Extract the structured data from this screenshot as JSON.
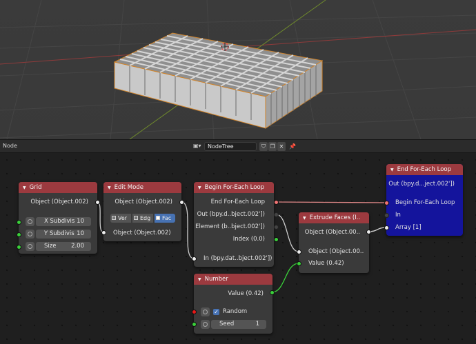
{
  "editor": {
    "type_label": "Node",
    "tree_name": "NodeTree"
  },
  "icons": {
    "tree_type": "node-tree-icon",
    "shield": "fake-user-shield-icon",
    "duplicate": "duplicate-icon",
    "close": "unlink-x-icon",
    "pin": "pin-icon"
  },
  "colors": {
    "node_header": "#9c3a3f",
    "active_node": "#14149c",
    "socket_object": "#ededed",
    "socket_value": "#3ad13a",
    "highlight": "#4772b3"
  },
  "nodes": {
    "grid": {
      "title": "Grid",
      "output": "Object (Object.002)",
      "x_label": "X Subdivis",
      "x_value": "10",
      "y_label": "Y Subdivis",
      "y_value": "10",
      "size_label": "Size",
      "size_value": "2.00"
    },
    "edit_mode": {
      "title": "Edit Mode",
      "output": "Object (Object.002)",
      "modes": [
        "Ver",
        "Edg",
        "Fac"
      ],
      "input": "Object (Object.002)"
    },
    "begin_loop": {
      "title": "Begin For-Each Loop",
      "out_end": "End For-Each Loop",
      "out_object": "Out (bpy.d..bject.002'])",
      "out_element": "Element (b..bject.002'])",
      "out_index": "Index (0.0)",
      "input": "In (bpy.dat..bject.002'])"
    },
    "extrude": {
      "title": "Extrude Faces (I..",
      "output": "Object (Object.00..",
      "input_object": "Object (Object.00..",
      "input_value": "Value (0.42)"
    },
    "number": {
      "title": "Number",
      "output": "Value (0.42)",
      "random_label": "Random",
      "seed_label": "Seed",
      "seed_value": "1"
    },
    "end_loop": {
      "title": "End For-Each Loop",
      "output": "Out (bpy.d...ject.002'])",
      "in_begin": "Begin For-Each Loop",
      "in_in": "In",
      "in_array": "Array [1]"
    }
  }
}
